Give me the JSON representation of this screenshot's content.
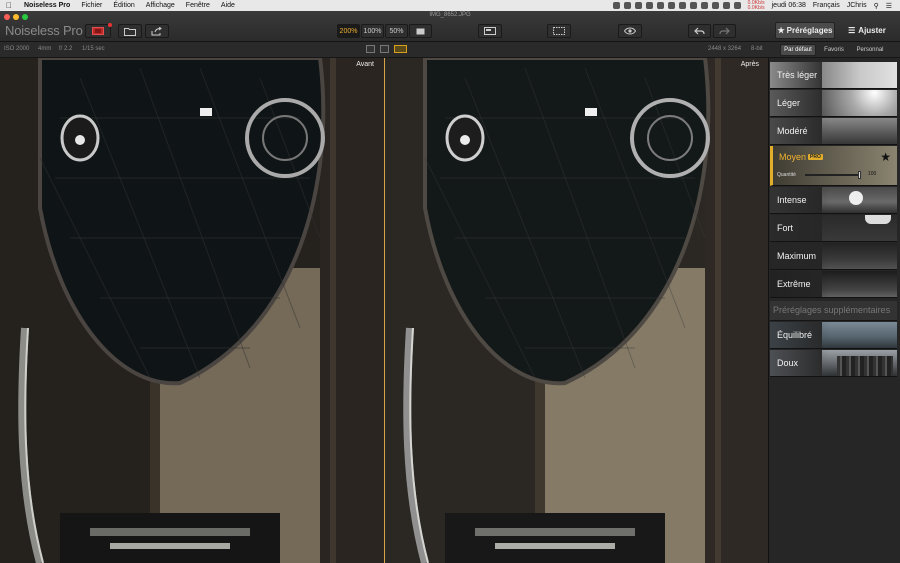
{
  "menubar": {
    "app_name": "Noiseless Pro",
    "items": [
      "Fichier",
      "Édition",
      "Affichage",
      "Fenêtre",
      "Aide"
    ],
    "clock": "jeudi 06:38",
    "language": "Français",
    "user": "JChris",
    "net_up": "0.0Kb/s",
    "net_down": "0.0Kb/s"
  },
  "titlebar": {
    "document": "IMG_8652.JPG",
    "app_title": "Noiseless Pro",
    "zoom": [
      "200%",
      "100%",
      "50%"
    ],
    "zoom_selected": "200%"
  },
  "tabs": {
    "presets": "Préréglages",
    "adjust": "Ajuster",
    "active": "presets"
  },
  "infobar": {
    "iso": "ISO 2000",
    "focal": "4mm",
    "aperture": "f/ 2.2",
    "shutter": "1/15 sec",
    "dimensions": "2448 x 3264",
    "bitdepth": "8-bit"
  },
  "filters": {
    "default": "Par défaut",
    "favorites": "Favoris",
    "personal": "Personnal",
    "active": "default"
  },
  "viewer": {
    "before": "Avant",
    "after": "Après"
  },
  "presets": [
    {
      "label": "Très léger"
    },
    {
      "label": "Léger"
    },
    {
      "label": "Modéré"
    },
    {
      "label": "Moyen",
      "badge": "PRO",
      "selected": true,
      "quantity_label": "Quantité",
      "quantity": "100"
    },
    {
      "label": "Intense"
    },
    {
      "label": "Fort"
    },
    {
      "label": "Maximum"
    },
    {
      "label": "Extrême"
    }
  ],
  "extra_section": {
    "title": "Préréglages supplémentaires",
    "items": [
      {
        "label": "Équilibré"
      },
      {
        "label": "Doux"
      }
    ]
  },
  "colors": {
    "accent": "#e1ad2b",
    "close": "#fc5f57",
    "minimize": "#fdbc2e",
    "zoom": "#28c840"
  },
  "icons": [
    "apple-icon",
    "import-icon",
    "folder-icon",
    "share-icon",
    "crop-icon",
    "compare-icon",
    "eye-icon",
    "undo-icon",
    "redo-icon",
    "star-icon",
    "sliders-icon"
  ]
}
